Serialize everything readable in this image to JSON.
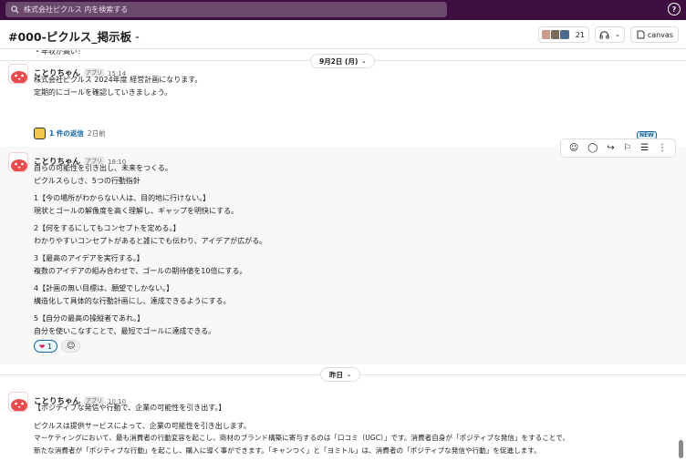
{
  "search": {
    "placeholder": "株式会社ピクルス 内を検索する"
  },
  "header": {
    "channel": "#000-ピクルス_掲示板",
    "member_count": "21",
    "canvas_label": "canvas"
  },
  "top_partial": "・年収が高い！",
  "date_pills": [
    "9月2日 (月)",
    "昨日"
  ],
  "messages": [
    {
      "name": "ことりちゃん",
      "badge": "アプリ",
      "time": "15:14",
      "lines": [
        "株式会社ピクルス 2024年度 経営計画になります。",
        "定期的にゴールを確認していきましょう。"
      ],
      "replies": "1 件の返信",
      "reply_time": "2日前"
    },
    {
      "name": "ことりちゃん",
      "badge": "アプリ",
      "time": "18:10",
      "lines": [
        "自らの可能性を引き出し、未来をつくる。",
        "ピクルスらしさ、5つの行動指針",
        "1【今の場所がわからない人は、目的地に行けない。】",
        "現状とゴールの解像度を高く理解し、ギャップを明快にする。",
        "2【何をするにしてもコンセプトを定める。】",
        "わかりやすいコンセプトがあると誰にでも伝わり、アイデアが広がる。",
        "3【最高のアイデアを実行する。】",
        "複数のアイデアの組み合わせで、ゴールの期待値を10倍にする。",
        "4【計画の無い目標は、願望でしかない。】",
        "構造化して具体的な行動計画にし、達成できるようにする。",
        "5【自分の最高の操縦者であれ。】",
        "自分を使いこなすことで、最短でゴールに達成できる。"
      ],
      "reaction_count": "1",
      "new_badge": "NEW"
    },
    {
      "name": "ことりちゃん",
      "badge": "アプリ",
      "time": "10:10",
      "lines": [
        "【ポジティブな発信や行動で、企業の可能性を引き出す。】",
        "ピクルスは提供サービスによって、企業の可能性を引き出します。",
        "マーケティングにおいて、最も消費者の行動変容を起こし、商材のブランド構築に寄与するのは「口コミ（UGC）」です。消費者自身が「ポジティブな発信」をすることで、",
        "新たな消費者が「ポジティブな行動」を起こし、購入に導く事ができます。「キャンつく」と「ヨミトル」は、消費者の「ポジティブな発信や行動」を促進します。"
      ]
    }
  ],
  "colors": {
    "topbar": "#3f0e40",
    "link": "#1264a3",
    "reaction": "#e01e5a"
  }
}
